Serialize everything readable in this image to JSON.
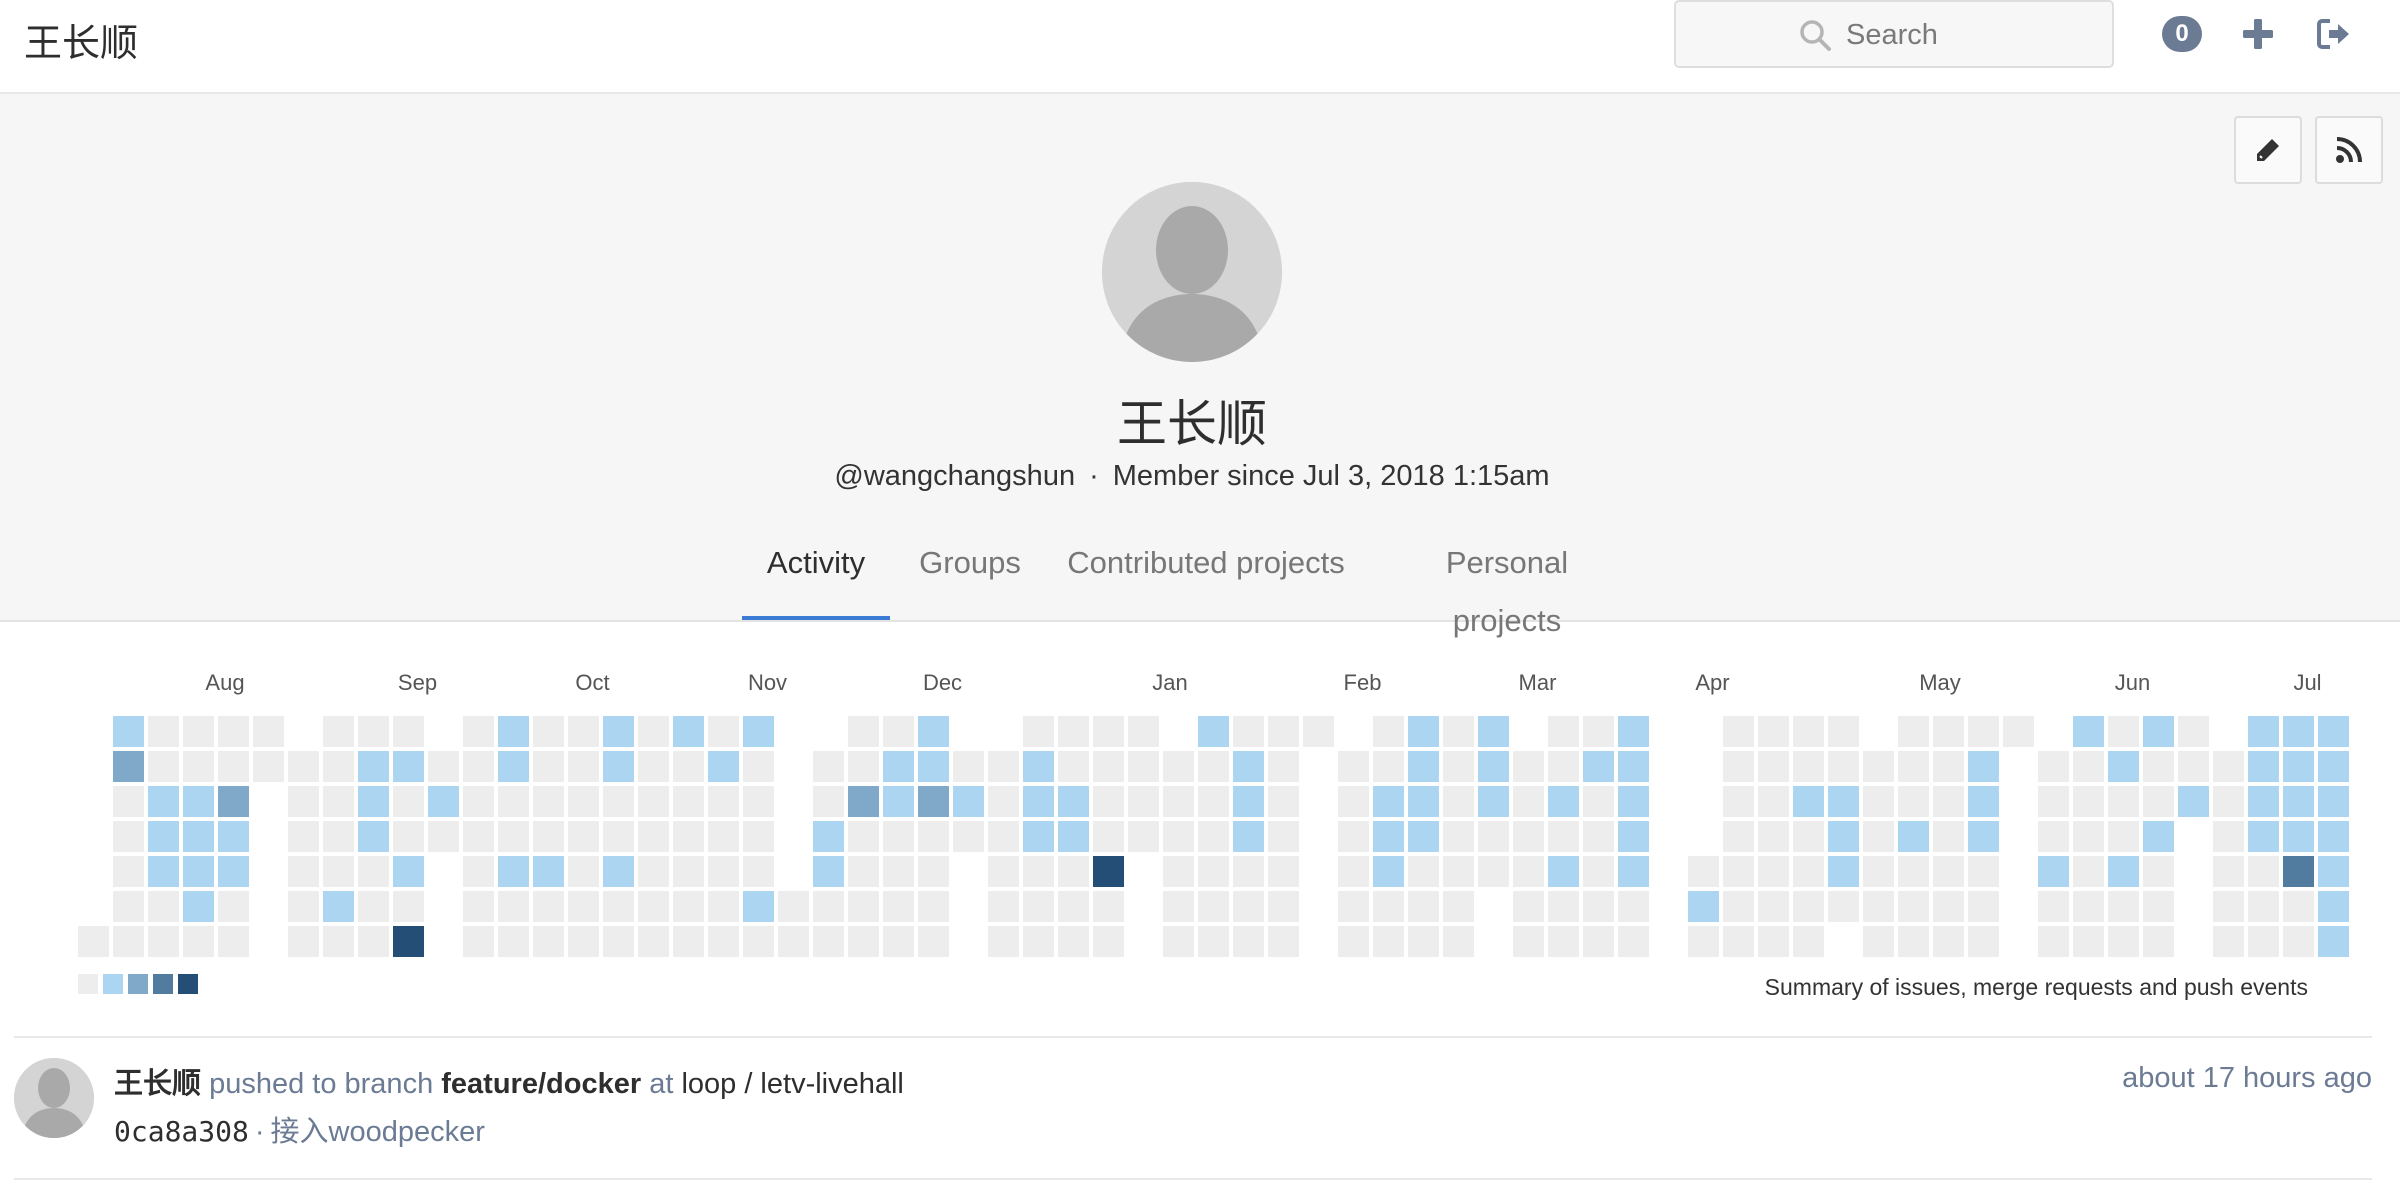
{
  "header": {
    "brand": "王长顺",
    "search_placeholder": "Search",
    "notifications_count": "0"
  },
  "profile": {
    "name": "王长顺",
    "username": "@wangchangshun",
    "member_since": "Member since Jul 3, 2018 1:15am",
    "tabs": [
      {
        "label": "Activity",
        "active": true
      },
      {
        "label": "Groups",
        "active": false
      },
      {
        "label": "Contributed projects",
        "active": false
      },
      {
        "label": "Personal projects",
        "active": false
      }
    ]
  },
  "calendar": {
    "months": [
      "Aug",
      "Sep",
      "Oct",
      "Nov",
      "Dec",
      "Jan",
      "Feb",
      "Mar",
      "Apr",
      "May",
      "Jun",
      "Jul"
    ],
    "summary": "Summary of issues, merge requests and push events",
    "colors": {
      "0": "#ededed",
      "1": "#acd5f2",
      "2": "#7fa8c9",
      "3": "#527ba0",
      "4": "#254e77"
    },
    "weeks": [
      "xxxxxx0",
      "1200000",
      "0011100",
      "0011110",
      "0021100",
      "00xxxxx",
      "x000000",
      "0000010",
      "0111000",
      "0100104",
      "x010xxx",
      "0000000",
      "1100100",
      "0000100",
      "0000000",
      "1100100",
      "0000000",
      "1000000",
      "0100000",
      "1000010",
      "xxxxx00",
      "x001100",
      "0020000",
      "0110000",
      "1120000",
      "x010xxx",
      "x000000",
      "0111000",
      "0011000",
      "0000400",
      "0000xxx",
      "x000000",
      "1000000",
      "0111000",
      "0000000",
      "0xxxxxx",
      "x000000",
      "0011100",
      "1111000",
      "0000000",
      "11100xx",
      "x000000",
      "0010100",
      "0100000",
      "1111100",
      "xxxxxxx",
      "xxxx010",
      "0000000",
      "0000000",
      "0010000",
      "001110x",
      "x000000",
      "0001000",
      "0000000",
      "0111000",
      "0xxxxxx",
      "x000100",
      "1000000",
      "0100100",
      "1001000",
      "001xxxx",
      "x000000",
      "1111000",
      "1111300",
      "1111111"
    ]
  },
  "activity": [
    {
      "author": "王长顺",
      "action": "pushed to branch",
      "branch": "feature/docker",
      "at": "at",
      "project": "loop / letv-livehall",
      "time": "about 17 hours ago",
      "sha": "0ca8a308",
      "sep": "·",
      "message": "接入woodpecker"
    }
  ],
  "icons": {
    "search": "search-icon",
    "plus": "plus-icon",
    "sign_out": "sign-out-icon",
    "pencil": "pencil-icon",
    "rss": "rss-icon"
  }
}
